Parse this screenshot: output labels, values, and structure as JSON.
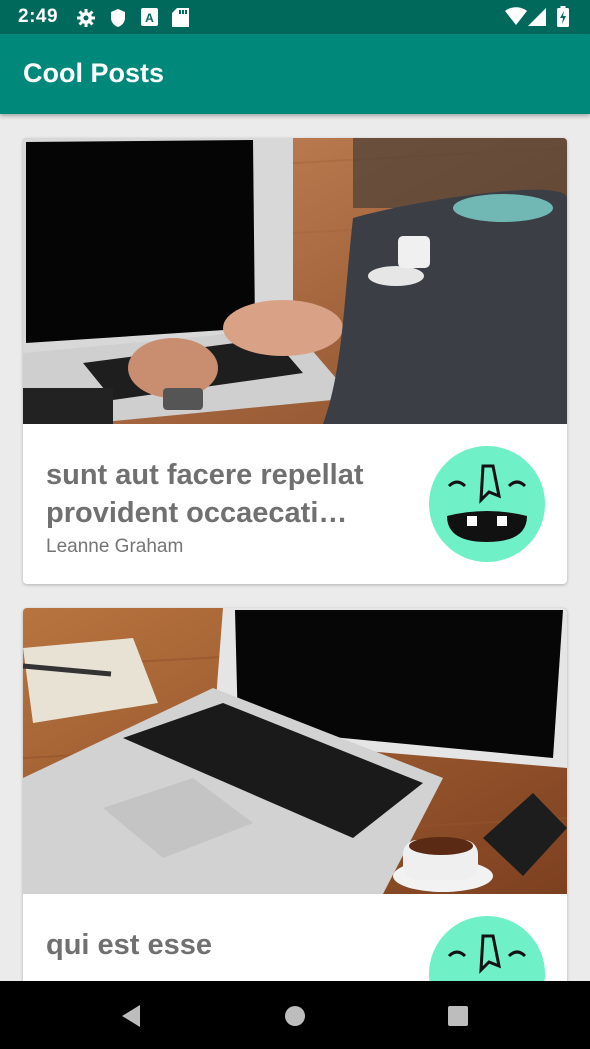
{
  "status_bar": {
    "time": "2:49",
    "icons": [
      "gear-icon",
      "shield-icon",
      "a-box-icon",
      "sd-card-icon",
      "wifi-icon",
      "signal-icon",
      "battery-icon"
    ]
  },
  "app_bar": {
    "title": "Cool Posts"
  },
  "posts": [
    {
      "title": "sunt aut facere repellat provident occaecati excepturi optio reprehenderit",
      "author": "Leanne Graham"
    },
    {
      "title": "qui est esse",
      "author": ""
    }
  ],
  "colors": {
    "status_bar": "#00695c",
    "app_bar": "#00897b",
    "avatar": "#6ff0c6",
    "background": "#ebebeb"
  },
  "nav_bar": {
    "icons": [
      "back-icon",
      "home-icon",
      "recents-icon"
    ]
  }
}
